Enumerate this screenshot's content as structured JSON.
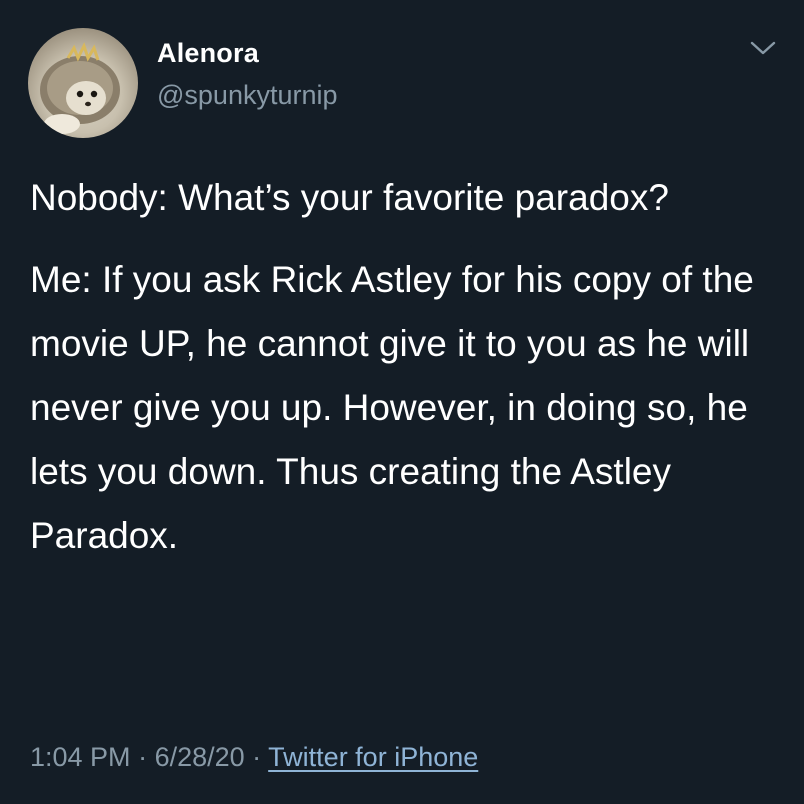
{
  "user": {
    "name": "Alenora",
    "handle": "@spunkyturnip",
    "avatar_icon": "hedgehog-avatar"
  },
  "menu_icon": "chevron-down-icon",
  "tweet": {
    "paragraph_1": "Nobody: What’s your favorite paradox?",
    "paragraph_2": "Me: If you ask Rick Astley for his copy of the movie UP, he cannot give it to you as he will never give you up. However, in doing so, he lets you down. Thus creating the Astley Paradox."
  },
  "meta": {
    "time": "1:04 PM",
    "separator": " · ",
    "date": "6/28/20",
    "source": "Twitter for iPhone"
  },
  "colors": {
    "background": "#141d26",
    "text": "#ffffff",
    "muted": "#8899a6"
  }
}
